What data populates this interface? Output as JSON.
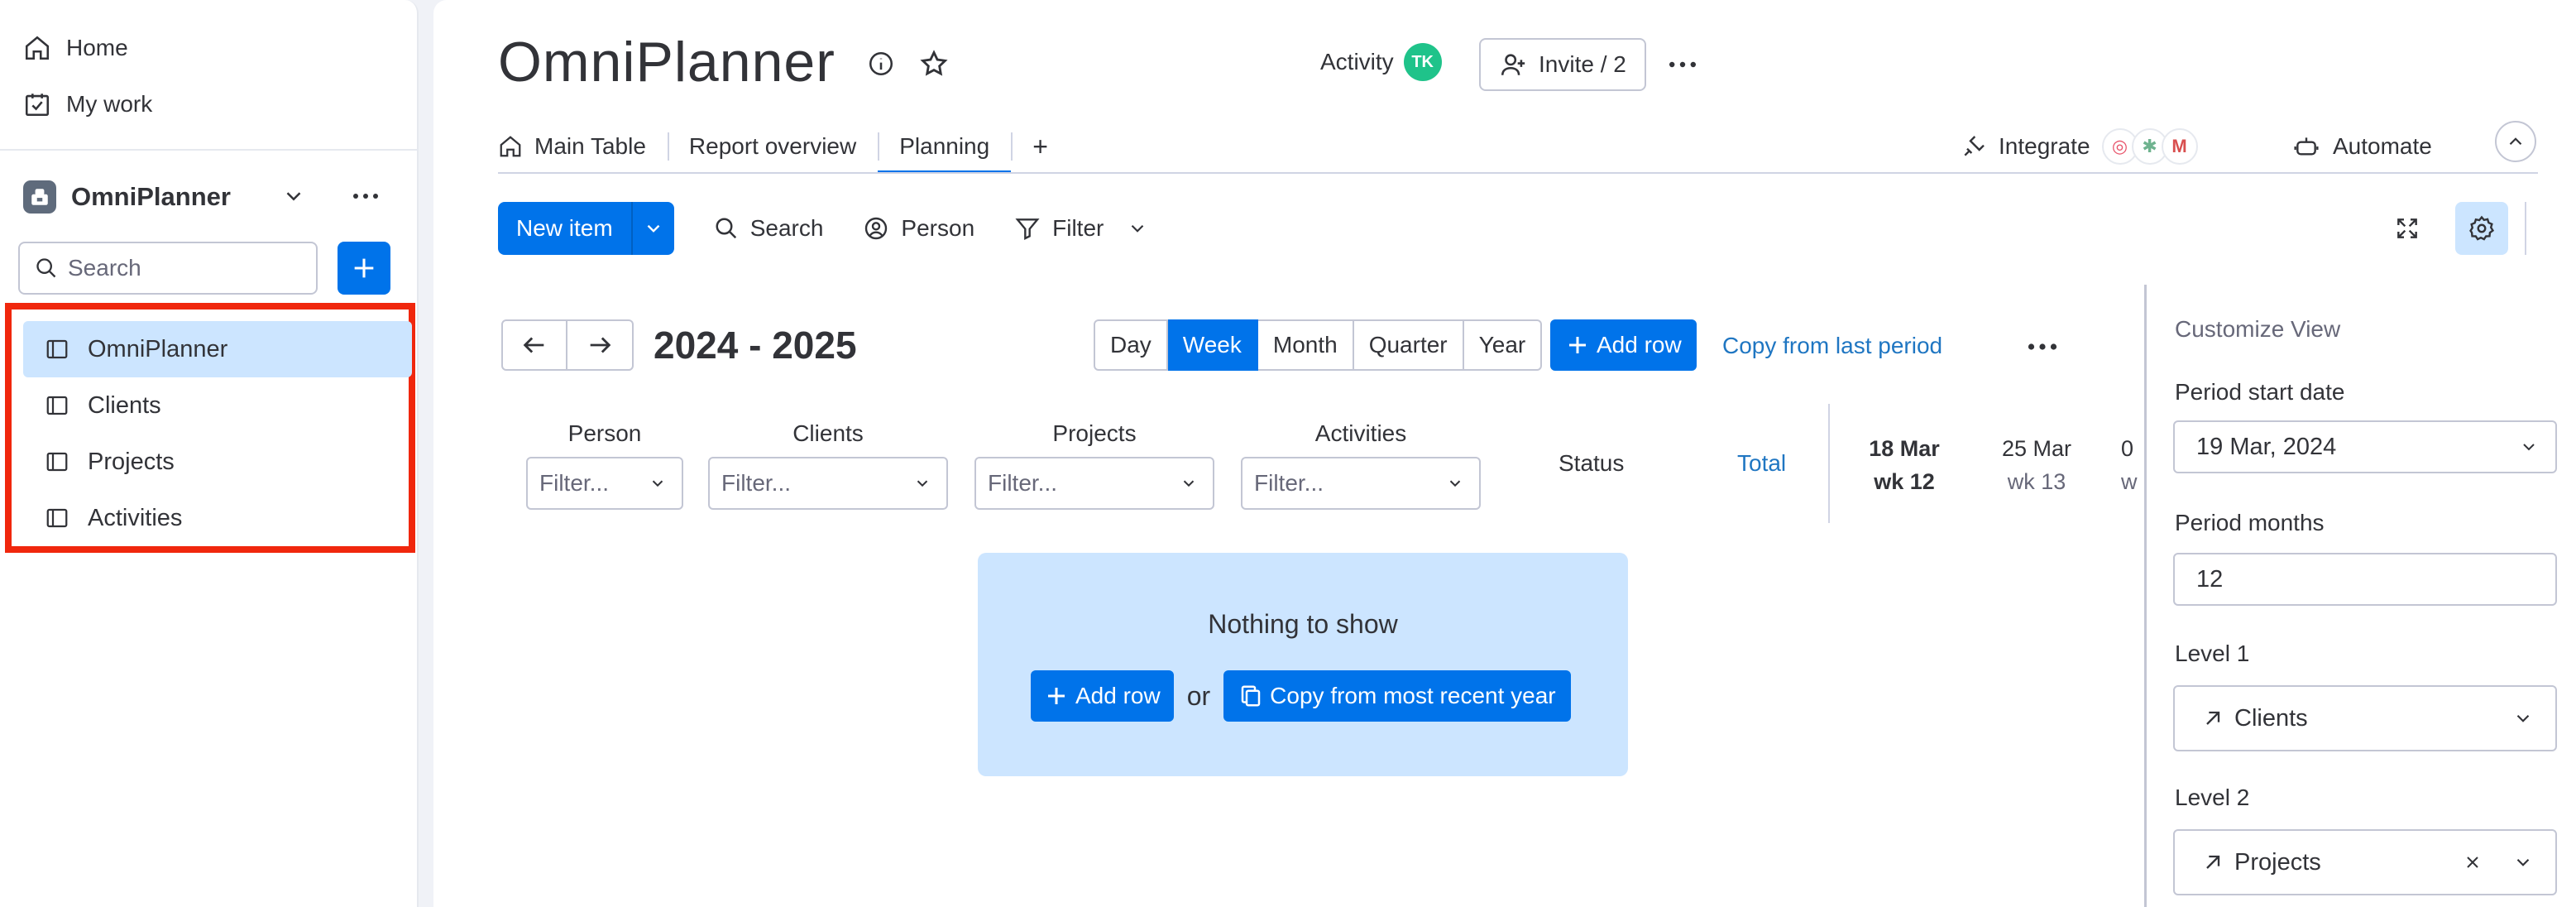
{
  "sidebar": {
    "nav": [
      {
        "label": "Home",
        "icon": "home-icon"
      },
      {
        "label": "My work",
        "icon": "calendar-check-icon"
      }
    ],
    "workspace": {
      "name": "OmniPlanner"
    },
    "search": {
      "placeholder": "Search"
    },
    "boards": [
      {
        "label": "OmniPlanner",
        "active": true
      },
      {
        "label": "Clients",
        "active": false
      },
      {
        "label": "Projects",
        "active": false
      },
      {
        "label": "Activities",
        "active": false
      }
    ]
  },
  "header": {
    "title": "OmniPlanner",
    "activity_label": "Activity",
    "avatar_initials": "TK",
    "invite_label": "Invite / 2",
    "integrate_label": "Integrate",
    "automate_label": "Automate"
  },
  "tabs": [
    {
      "label": "Main Table",
      "icon": "home-icon"
    },
    {
      "label": "Report overview"
    },
    {
      "label": "Planning",
      "active": true
    }
  ],
  "tab_add_label": "+",
  "toolbar": {
    "new_item_label": "New item",
    "search_label": "Search",
    "person_label": "Person",
    "filter_label": "Filter"
  },
  "planning": {
    "period": "2024 - 2025",
    "views": [
      "Day",
      "Week",
      "Month",
      "Quarter",
      "Year"
    ],
    "active_view": "Week",
    "add_row_label": "Add row",
    "copy_last_label": "Copy from last period",
    "columns": [
      {
        "label": "Person",
        "filter": "Filter..."
      },
      {
        "label": "Clients",
        "filter": "Filter..."
      },
      {
        "label": "Projects",
        "filter": "Filter..."
      },
      {
        "label": "Activities",
        "filter": "Filter..."
      }
    ],
    "status_label": "Status",
    "total_label": "Total",
    "weeks": [
      {
        "date": "18 Mar",
        "wk": "wk 12"
      },
      {
        "date": "25 Mar",
        "wk": "wk 13"
      },
      {
        "date": "0",
        "wk": "w"
      }
    ],
    "empty": {
      "title": "Nothing to show",
      "add_row_label": "Add row",
      "or_label": "or",
      "copy_label": "Copy from most recent year"
    }
  },
  "customize": {
    "title": "Customize View",
    "period_start_label": "Period start date",
    "period_start_value": "19 Mar, 2024",
    "period_months_label": "Period months",
    "period_months_value": "12",
    "level1_label": "Level 1",
    "level1_value": "Clients",
    "level2_label": "Level 2",
    "level2_value": "Projects"
  },
  "colors": {
    "accent": "#0073ea",
    "highlight": "#f0270d",
    "selected": "#cce5ff"
  }
}
